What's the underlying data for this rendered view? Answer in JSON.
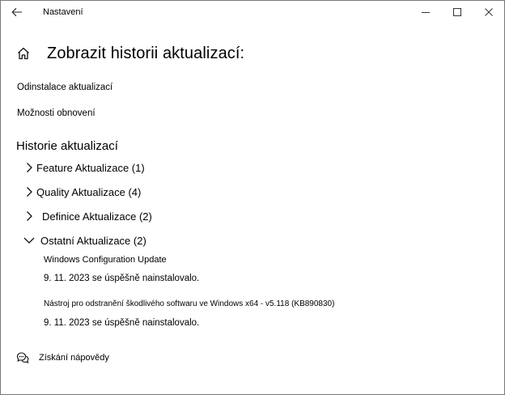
{
  "window": {
    "title": "Nastavení"
  },
  "header": {
    "title": "Zobrazit historii aktualizací:"
  },
  "links": {
    "uninstall": "Odinstalace aktualizací",
    "recovery": "Možnosti obnovení"
  },
  "history": {
    "title": "Historie aktualizací",
    "groups": [
      {
        "label": "Feature Aktualizace (1)",
        "expanded": false
      },
      {
        "label": "Quality Aktualizace (4)",
        "expanded": false
      },
      {
        "label": "Definice Aktualizace (2)",
        "expanded": false
      },
      {
        "label": "Ostatní Aktualizace (2)",
        "expanded": true
      }
    ],
    "entries": [
      {
        "name": "Windows Configuration Update",
        "status": "9. 11. 2023 se úspěšně nainstalovalo."
      },
      {
        "name": "Nástroj pro odstranění škodlivého softwaru ve Windows x64 - v5.118 (KB890830)",
        "status": "9. 11. 2023 se úspěšně nainstalovalo."
      }
    ]
  },
  "help": {
    "label": "Získání nápovědy"
  },
  "icons": {
    "back": "back-arrow-icon",
    "home": "home-icon",
    "help": "help-chat-icon",
    "collapsed": "chevron-right-icon",
    "expanded": "chevron-down-icon"
  }
}
